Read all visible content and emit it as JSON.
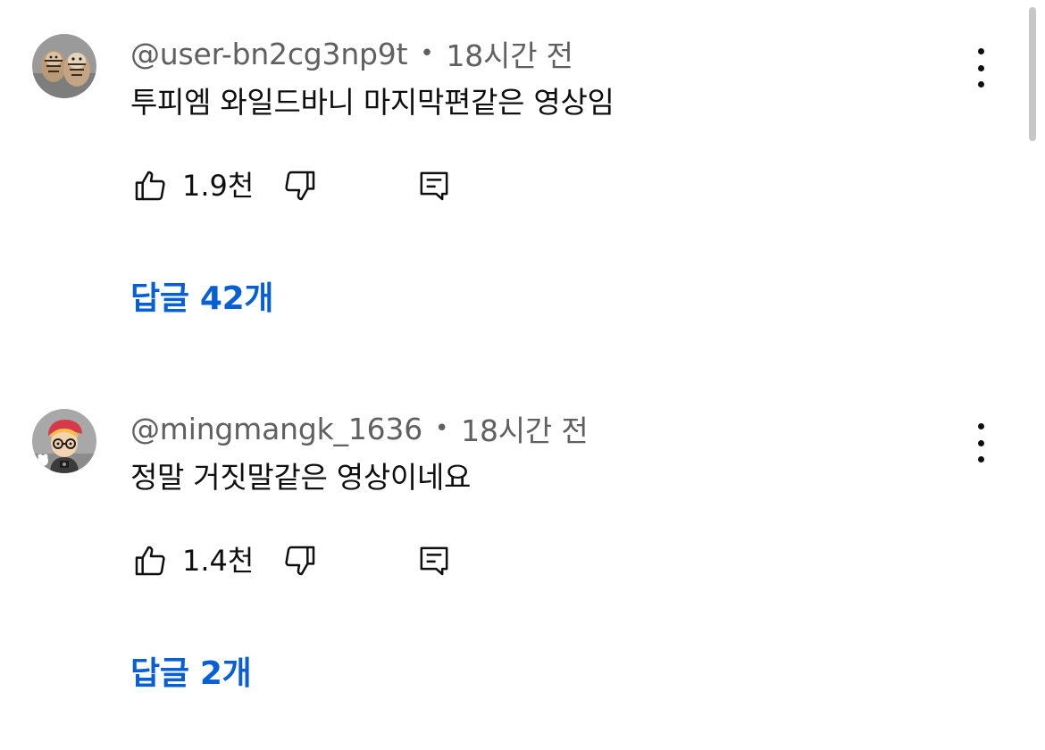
{
  "comments": [
    {
      "author": "@user-bn2cg3np9t",
      "separator": "•",
      "time": "18시간 전",
      "text": "투피엠 와일드바니 마지막편같은 영상임",
      "likes": "1.9천",
      "replies": "답글 42개",
      "avatar_icon": "tigers-photo-avatar"
    },
    {
      "author": "@mingmangk_1636",
      "separator": "•",
      "time": "18시간 전",
      "text": "정말 거짓말같은 영상이네요",
      "likes": "1.4천",
      "replies": "답글 2개",
      "avatar_icon": "cartoon-boy-avatar"
    }
  ],
  "icons": {
    "like": "thumbs-up-icon",
    "dislike": "thumbs-down-icon",
    "reply": "comment-reply-icon",
    "more": "more-vertical-icon"
  },
  "colors": {
    "text": "#0f0f0f",
    "secondary_text": "#606060",
    "link": "#065fd4",
    "scrollbar": "#c7c7c7"
  }
}
